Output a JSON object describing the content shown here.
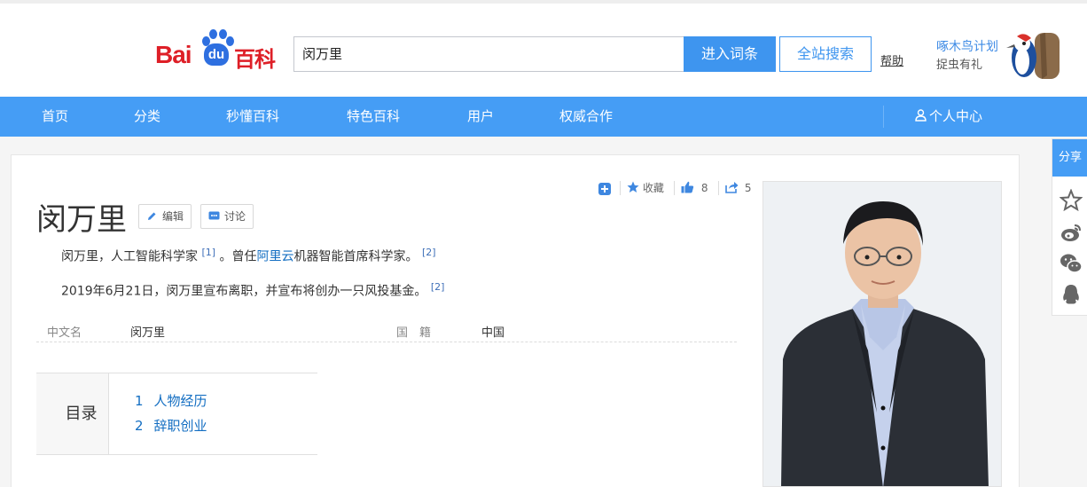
{
  "header": {
    "logo": "Baidu百科",
    "logo_bai": "Bai",
    "logo_du": "du",
    "logo_baike": "百科",
    "search_value": "闵万里",
    "enter_button": "进入词条",
    "site_search_button": "全站搜索",
    "help_link": "帮助",
    "promo_title": "啄木鸟计划",
    "promo_subtitle": "捉虫有礼"
  },
  "nav": {
    "items": [
      "首页",
      "分类",
      "秒懂百科",
      "特色百科",
      "用户",
      "权威合作"
    ],
    "user_center": "个人中心"
  },
  "article": {
    "title": "闵万里",
    "edit_button": "编辑",
    "discuss_button": "讨论",
    "actions": {
      "collect": "收藏",
      "likes": "8",
      "shares": "5"
    },
    "para1": {
      "text_a": "闵万里，人工智能科学家",
      "ref1": "[1]",
      "text_b": "。曾任",
      "link": "阿里云",
      "text_c": "机器智能首席科学家。",
      "ref2": "[2]"
    },
    "para2": {
      "text": "2019年6月21日，闵万里宣布离职，并宣布将创办一只风投基金。",
      "ref": "[2]"
    },
    "info": {
      "name_label": "中文名",
      "name_value": "闵万里",
      "nationality_label": "国　籍",
      "nationality_value": "中国"
    },
    "toc": {
      "heading": "目录",
      "items": [
        {
          "num": "1",
          "label": "人物经历"
        },
        {
          "num": "2",
          "label": "辞职创业"
        }
      ]
    }
  },
  "share": {
    "tab": "分享"
  },
  "colors": {
    "accent": "#459df5",
    "link": "#136ec2",
    "logo_red": "#de1f27",
    "logo_blue": "#2e6fe0"
  }
}
